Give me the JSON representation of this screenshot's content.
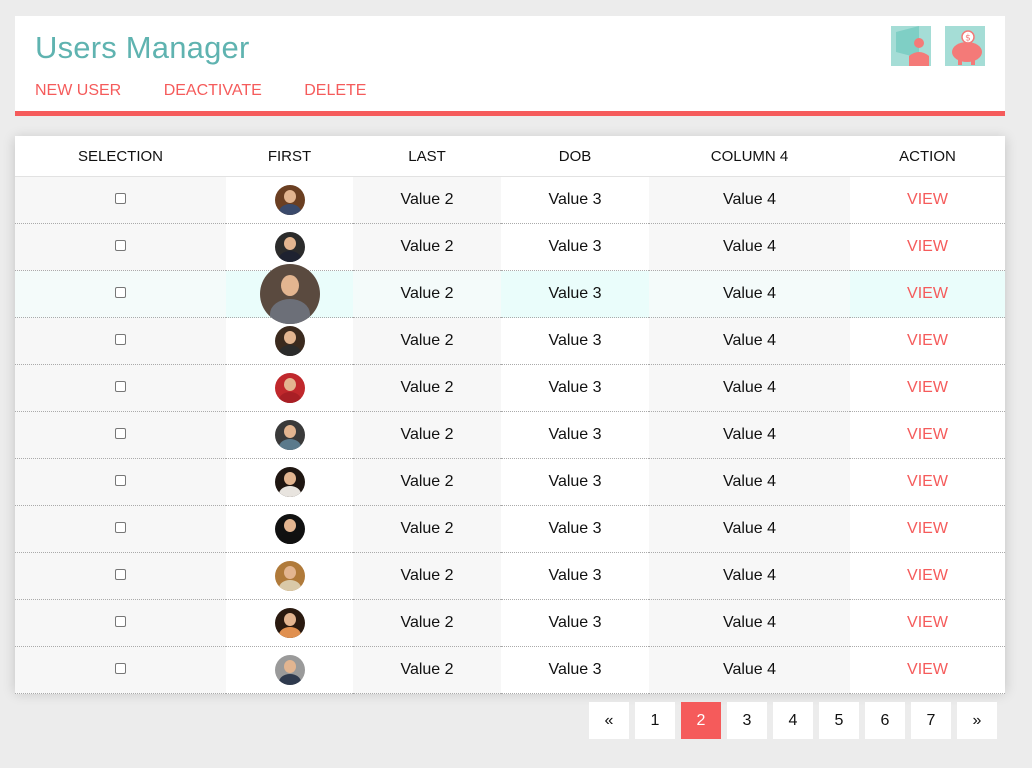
{
  "app": {
    "title": "Users Manager",
    "accent": "#f55b5b",
    "title_color": "#5fb3b0"
  },
  "menu": {
    "new_user": "NEW USER",
    "deactivate": "DEACTIVATE",
    "delete": "DELETE"
  },
  "header_icons": [
    "user-presentation-icon",
    "piggy-bank-icon"
  ],
  "table": {
    "columns": [
      "SELECTION",
      "FIRST",
      "LAST",
      "DOB",
      "COLUMN 4",
      "ACTION"
    ],
    "rows": [
      {
        "last": "Value 2",
        "dob": "Value 3",
        "c4": "Value 4",
        "action": "VIEW",
        "checked": false,
        "hair": "#6b3f22",
        "shirt": "#3a4a6b"
      },
      {
        "last": "Value 2",
        "dob": "Value 3",
        "c4": "Value 4",
        "action": "VIEW",
        "checked": false,
        "hair": "#2b2b2b",
        "shirt": "#1e2230"
      },
      {
        "last": "Value 2",
        "dob": "Value 3",
        "c4": "Value 4",
        "action": "VIEW",
        "checked": false,
        "hair": "#5a4a3f",
        "shirt": "#6c6f78",
        "highlight": true
      },
      {
        "last": "Value 2",
        "dob": "Value 3",
        "c4": "Value 4",
        "action": "VIEW",
        "checked": false,
        "hair": "#3b2a1e",
        "shirt": "#2b2b2b"
      },
      {
        "last": "Value 2",
        "dob": "Value 3",
        "c4": "Value 4",
        "action": "VIEW",
        "checked": false,
        "hair": "#c0282c",
        "shirt": "#a81f25"
      },
      {
        "last": "Value 2",
        "dob": "Value 3",
        "c4": "Value 4",
        "action": "VIEW",
        "checked": false,
        "hair": "#3a3a3a",
        "shirt": "#5b7a8c"
      },
      {
        "last": "Value 2",
        "dob": "Value 3",
        "c4": "Value 4",
        "action": "VIEW",
        "checked": false,
        "hair": "#1f1612",
        "shirt": "#e8e4df"
      },
      {
        "last": "Value 2",
        "dob": "Value 3",
        "c4": "Value 4",
        "action": "VIEW",
        "checked": false,
        "hair": "#111111",
        "shirt": "#101010"
      },
      {
        "last": "Value 2",
        "dob": "Value 3",
        "c4": "Value 4",
        "action": "VIEW",
        "checked": false,
        "hair": "#b07a3a",
        "shirt": "#d9c9a8"
      },
      {
        "last": "Value 2",
        "dob": "Value 3",
        "c4": "Value 4",
        "action": "VIEW",
        "checked": false,
        "hair": "#2a1a10",
        "shirt": "#e09050"
      },
      {
        "last": "Value 2",
        "dob": "Value 3",
        "c4": "Value 4",
        "action": "VIEW",
        "checked": false,
        "hair": "#9a9a9a",
        "shirt": "#2f3a4e"
      }
    ]
  },
  "pagination": {
    "prev": "«",
    "pages": [
      "1",
      "2",
      "3",
      "4",
      "5",
      "6",
      "7"
    ],
    "current": "2",
    "next": "»"
  }
}
